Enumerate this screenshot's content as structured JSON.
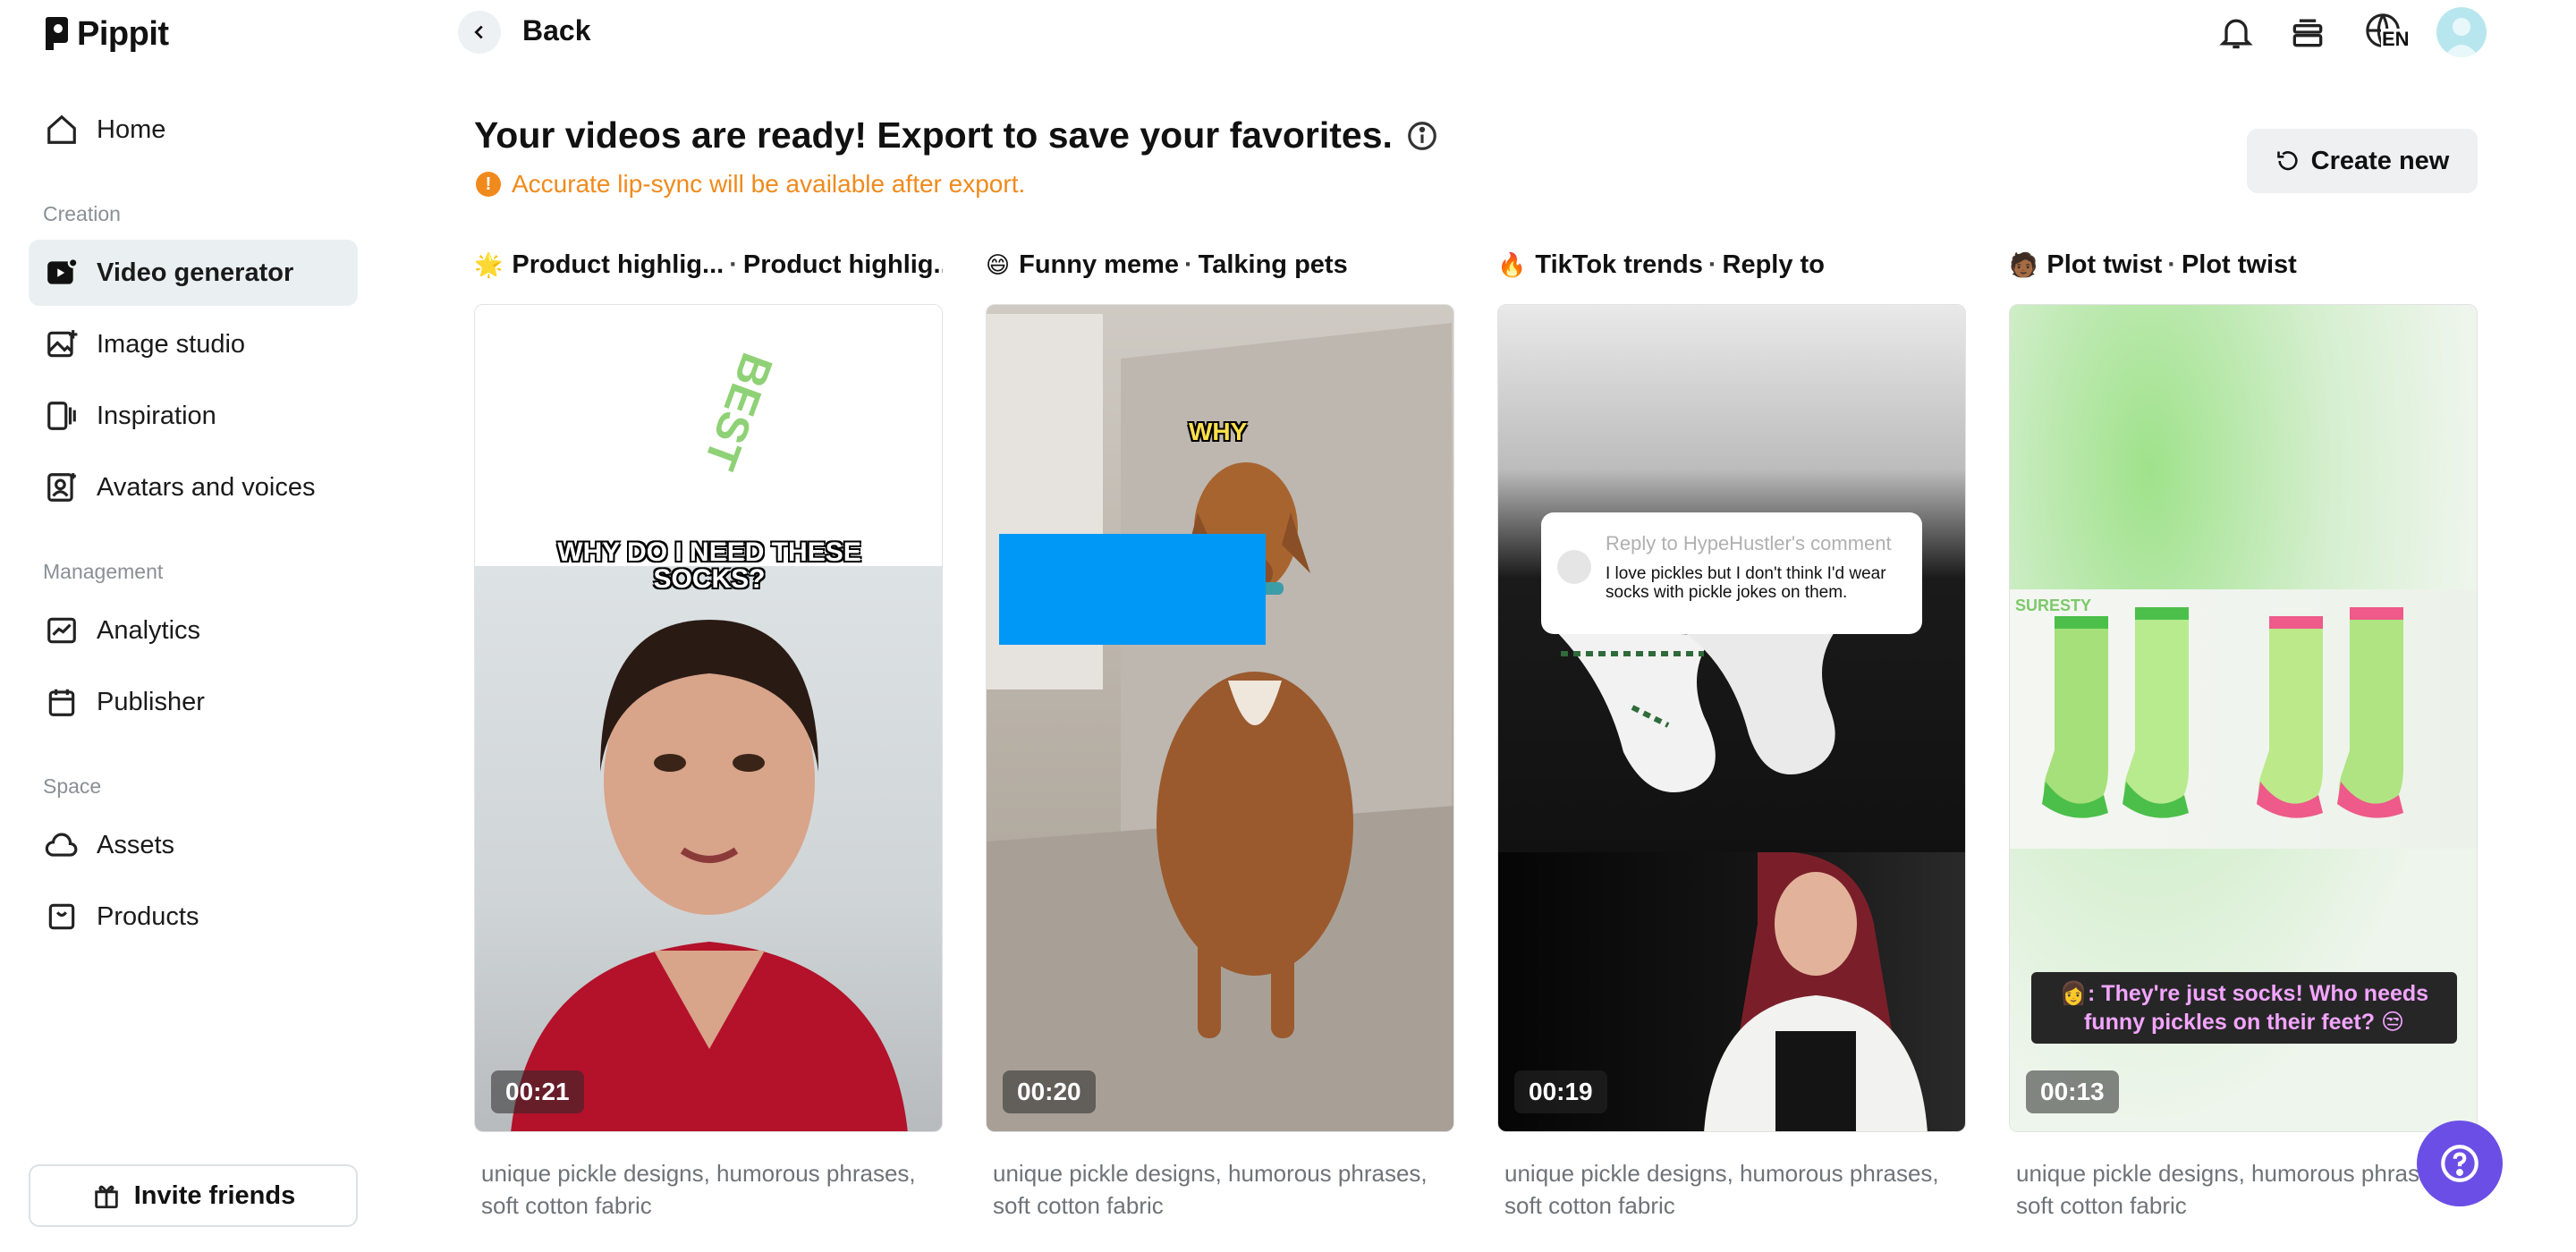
{
  "app": {
    "name": "Pippit"
  },
  "sidebar": {
    "items_top": [
      {
        "label": "Home",
        "icon": "home-icon"
      }
    ],
    "sections": [
      {
        "label": "Creation",
        "items": [
          {
            "label": "Video generator",
            "icon": "video-generator-icon",
            "active": true
          },
          {
            "label": "Image studio",
            "icon": "image-studio-icon"
          },
          {
            "label": "Inspiration",
            "icon": "inspiration-icon"
          },
          {
            "label": "Avatars and voices",
            "icon": "avatar-icon"
          }
        ]
      },
      {
        "label": "Management",
        "items": [
          {
            "label": "Analytics",
            "icon": "analytics-icon"
          },
          {
            "label": "Publisher",
            "icon": "calendar-icon"
          }
        ]
      },
      {
        "label": "Space",
        "items": [
          {
            "label": "Assets",
            "icon": "cloud-icon"
          },
          {
            "label": "Products",
            "icon": "box-icon"
          }
        ]
      }
    ],
    "invite_label": "Invite friends"
  },
  "topbar": {
    "back_label": "Back",
    "language": "EN"
  },
  "main": {
    "heading": "Your videos are ready! Export to save your favorites.",
    "notice": "Accurate lip-sync will be available after export.",
    "notice_icon": "!",
    "create_new_label": "Create new",
    "cards": [
      {
        "emoji": "🌟",
        "title": "Product highlig...",
        "subtitle": "Product highlig...",
        "duration": "00:21",
        "description": "unique pickle designs, humorous phrases, soft cotton fabric",
        "overlay_text": "WHY DO I NEED THESE SOCKS?",
        "art_text": "BEST"
      },
      {
        "emoji": "😄",
        "title": "Funny meme",
        "subtitle": "Talking pets",
        "duration": "00:20",
        "description": "unique pickle designs, humorous phrases, soft cotton fabric",
        "overlay_text": "WHY"
      },
      {
        "emoji": "🔥",
        "title": "TikTok trends",
        "subtitle": "Reply to",
        "duration": "00:19",
        "description": "unique pickle designs, humorous phrases, soft cotton fabric",
        "reply_head": "Reply to HypeHustler's comment",
        "reply_body": "I love pickles but I don't think I'd wear socks with pickle jokes on them."
      },
      {
        "emoji": "🧑🏾",
        "title": "Plot twist",
        "subtitle": "Plot twist",
        "duration": "00:13",
        "description": "unique pickle designs, humorous phrases, soft cotton fabric",
        "overlay_text": "👩: They're just socks! Who needs funny pickles on their feet? 😒",
        "brand_text": "SURESTY"
      }
    ]
  },
  "colors": {
    "accent_orange": "#f08a1c",
    "active_bg": "#eaf0f2",
    "help_purple": "#6b4ee6"
  }
}
